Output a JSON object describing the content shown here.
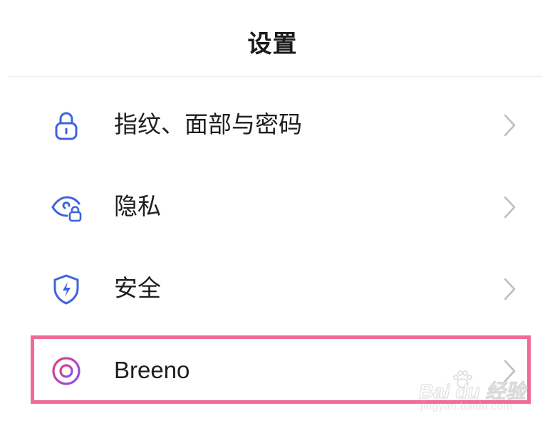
{
  "header": {
    "title": "设置"
  },
  "settings": {
    "items": [
      {
        "label": "指纹、面部与密码",
        "icon": "lock-icon"
      },
      {
        "label": "隐私",
        "icon": "privacy-eye-icon"
      },
      {
        "label": "安全",
        "icon": "security-shield-icon"
      },
      {
        "label": "Breeno",
        "icon": "breeno-ring-icon",
        "highlighted": true
      }
    ]
  },
  "colors": {
    "icon_blue": "#3d63dd",
    "breeno_gradient_start": "#e0407f",
    "breeno_gradient_end": "#8a4df0",
    "highlight_border": "#f06b98",
    "chevron": "#bdbdbd",
    "text": "#1e1e1e"
  },
  "watermark": {
    "brand": "Bai du 经验",
    "url": "jingyan.baidu.com"
  }
}
